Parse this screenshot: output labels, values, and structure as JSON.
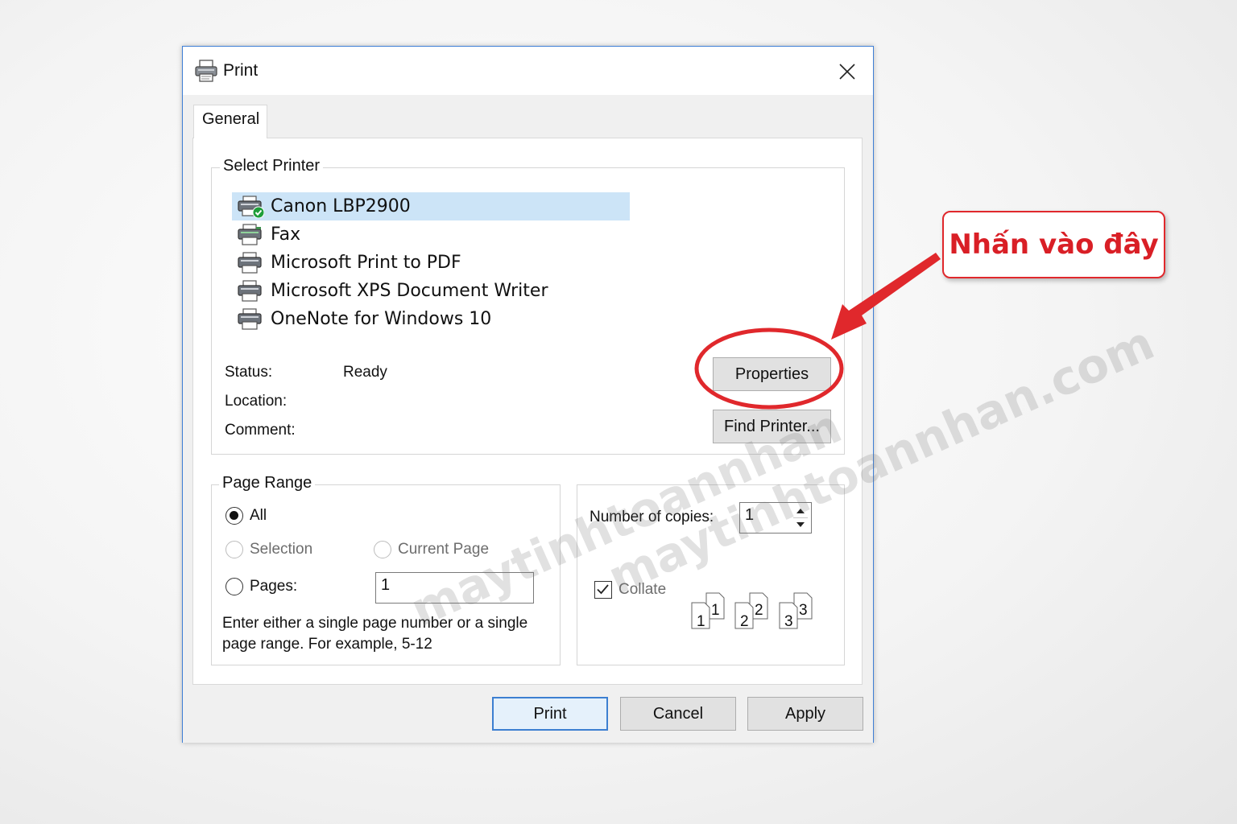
{
  "window": {
    "title": "Print"
  },
  "tabs": [
    {
      "label": "General"
    }
  ],
  "select_printer": {
    "title": "Select Printer",
    "printers": [
      {
        "name": "Canon LBP2900",
        "selected": true,
        "icon": "printer-default-icon"
      },
      {
        "name": "Fax",
        "selected": false,
        "icon": "fax-printer-icon"
      },
      {
        "name": "Microsoft Print to PDF",
        "selected": false,
        "icon": "printer-icon"
      },
      {
        "name": "Microsoft XPS Document Writer",
        "selected": false,
        "icon": "printer-icon"
      },
      {
        "name": "OneNote for Windows 10",
        "selected": false,
        "icon": "printer-icon"
      }
    ],
    "status_label": "Status:",
    "status_value": "Ready",
    "location_label": "Location:",
    "comment_label": "Comment:",
    "properties_button": "Properties",
    "find_printer_button": "Find Printer..."
  },
  "page_range": {
    "title": "Page Range",
    "all_label": "All",
    "selection_label": "Selection",
    "current_page_label": "Current Page",
    "pages_label": "Pages:",
    "pages_value": "1",
    "selected_option": "All",
    "hint": "Enter either a single page number or a single page range.  For example, 5-12"
  },
  "copies": {
    "label": "Number of copies:",
    "value": "1",
    "collate_label": "Collate",
    "collate_checked": true,
    "collate_pages": [
      "1",
      "1",
      "2",
      "2",
      "3",
      "3"
    ]
  },
  "footer": {
    "print": "Print",
    "cancel": "Cancel",
    "apply": "Apply"
  },
  "annotation": {
    "callout_text": "Nhấn vào đây",
    "color": "#e0282c"
  },
  "watermarks": [
    "maytinhtoannhan",
    "maytinhtoannhan.com"
  ]
}
